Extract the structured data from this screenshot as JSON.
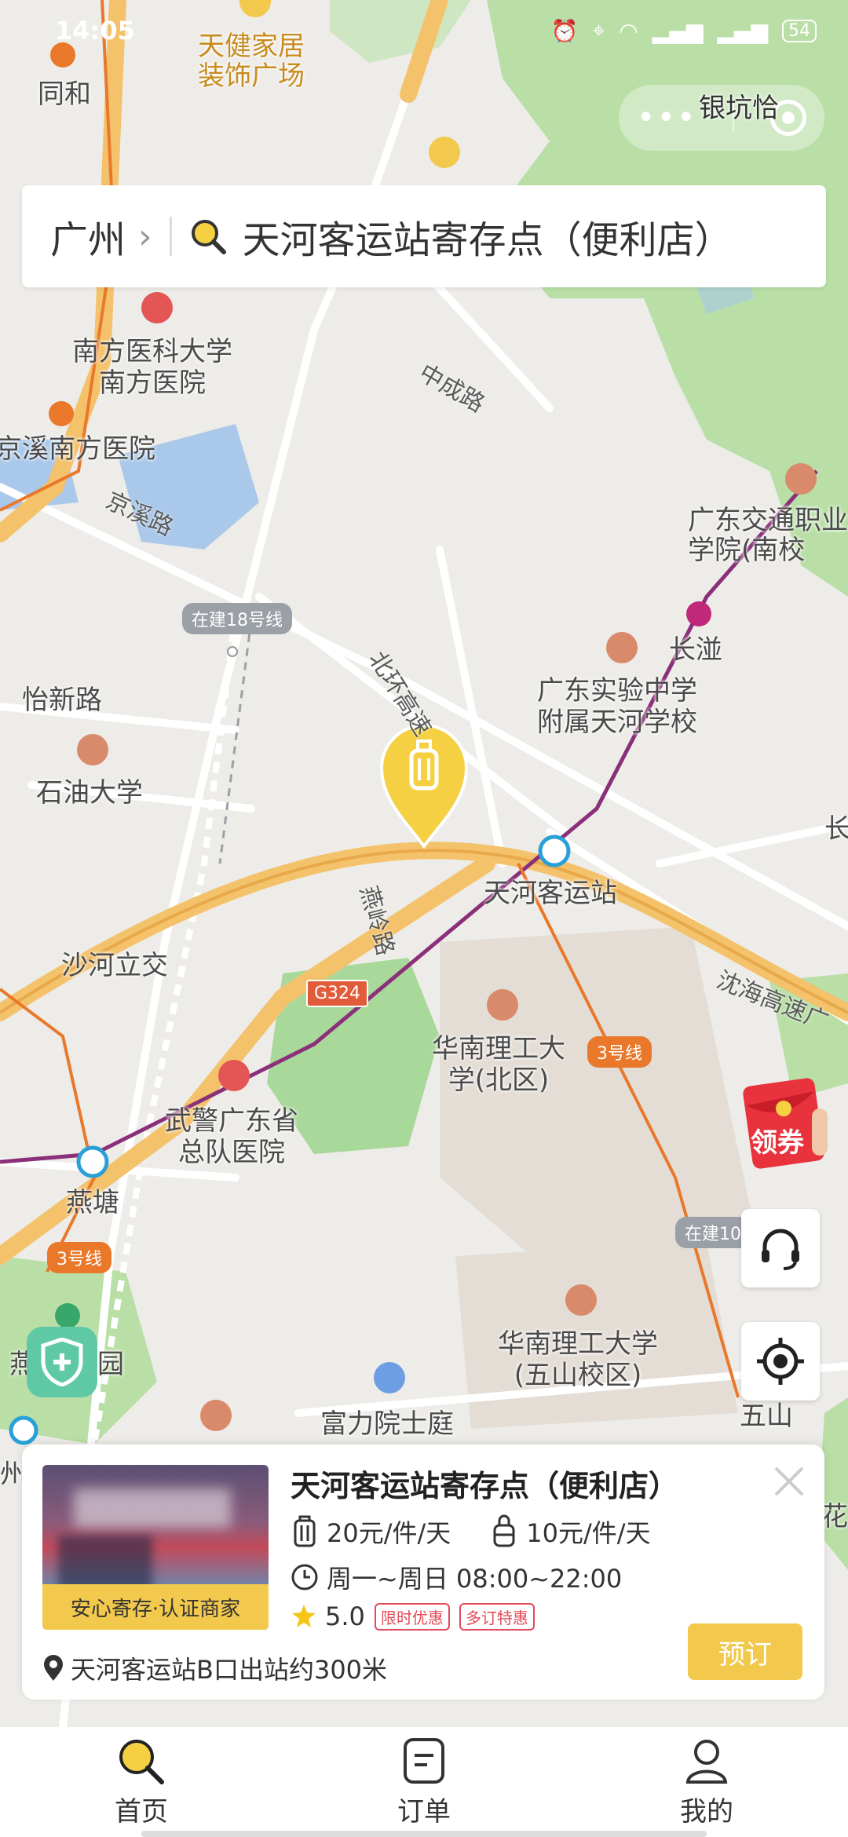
{
  "status_bar": {
    "time": "14:05",
    "battery": "54"
  },
  "capsule": {
    "location_text": "银坑恰"
  },
  "search": {
    "city": "广州",
    "query": "天河客运站寄存点（便利店）"
  },
  "map": {
    "labels": {
      "tonghe": "同和",
      "tianjian": "天健家居\n装饰广场",
      "nanfang_univ": "南方医科大学\n南方医院",
      "jingxi_hospital": "京溪南方医院",
      "jingxi_road": "京溪路",
      "zhongcheng": "中成路",
      "gd_transport": "广东交通职业\n学院(南校",
      "changban": "长湴",
      "gd_exp_school": "广东实验中学\n附属天河学校",
      "yixin": "怡新路",
      "shiyou": "石油大学",
      "beisi": "北环高速",
      "tianhe_station": "天河客运站",
      "yanling": "燕岭路",
      "shahe": "沙河立交",
      "huanan_north": "华南理工大\n学(北区)",
      "wujing": "武警广东省\n总队医院",
      "yantang": "燕塘",
      "shenhai": "沈海高速广",
      "huanan_wushan": "华南理工大学\n(五山校区)",
      "fuli": "富力院士庭",
      "wushan": "五山",
      "yan_park": "燕",
      "park": "园",
      "chang_right": "长",
      "hua": "花",
      "zhou": "州"
    },
    "line_tags": {
      "line18": "在建18号线",
      "line3a": "3号线",
      "line3b": "3号线",
      "line10": "在建10"
    },
    "highway": "G324"
  },
  "coupon": {
    "label": "领券"
  },
  "store_card": {
    "title": "天河客运站寄存点（便利店）",
    "price_large": "20元/件/天",
    "price_small": "10元/件/天",
    "hours": "周一~周日 08:00~22:00",
    "rating": "5.0",
    "tag1": "限时优惠",
    "tag2": "多订特惠",
    "thumb_badge": "安心寄存·认证商家",
    "address": "天河客运站B口出站约300米",
    "book_label": "预订"
  },
  "nav": {
    "home": "首页",
    "orders": "订单",
    "mine": "我的"
  },
  "colors": {
    "accent": "#f2c94c",
    "brand_yellow": "#f5d042"
  }
}
